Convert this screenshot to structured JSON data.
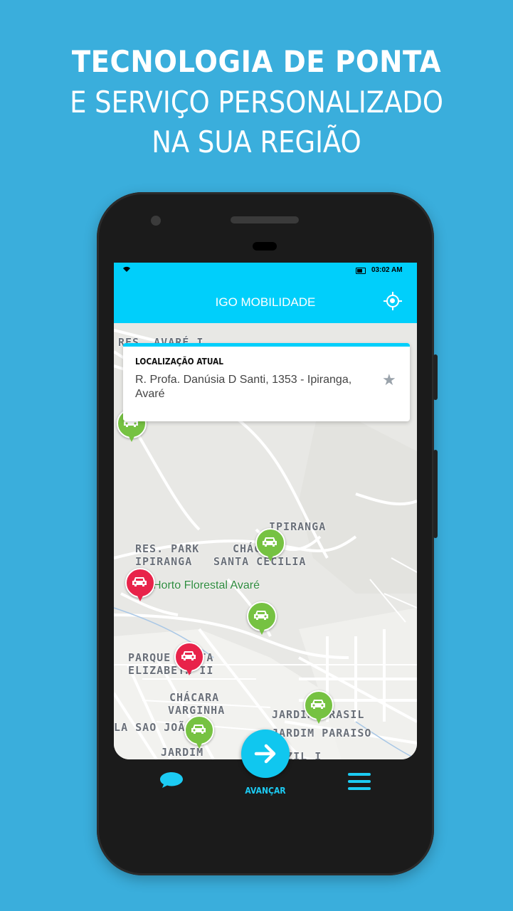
{
  "headline": {
    "line1": "TECNOLOGIA DE PONTA",
    "line2": "E SERVIÇO PERSONALIZADO",
    "line3": "NA SUA REGIÃO"
  },
  "status_bar": {
    "time": "03:02 AM"
  },
  "app_bar": {
    "title": "IGO MOBILIDADE",
    "locate_icon": "crosshair-icon"
  },
  "location_card": {
    "label": "LOCALIZAÇÃO ATUAL",
    "address": "R. Profa. Danúsia D Santi, 1353  -  Ipiranga, Avaré",
    "favorite_icon": "star-icon"
  },
  "map": {
    "labels": [
      "RES. AVARÉ I",
      "IPIRANGA",
      "RES. PARK",
      "IPIRANGA",
      "CHÁCARA",
      "SANTA CECILIA",
      "PARQUE SANTA",
      "ELIZABETH II",
      "CHÁCARA",
      "VARGINHA",
      "JARDIM BRASIL",
      "JARDIM PARAISO",
      "VILA SAO JOÃO",
      "JARDIM",
      "CRUZIL I"
    ],
    "park_label": "Horto Florestal Avaré",
    "pins": [
      {
        "color": "green"
      },
      {
        "color": "green"
      },
      {
        "color": "green"
      },
      {
        "color": "green"
      },
      {
        "color": "green"
      },
      {
        "color": "green"
      },
      {
        "color": "red"
      },
      {
        "color": "red"
      }
    ]
  },
  "bottom_nav": {
    "chat_icon": "chat-bubble-icon",
    "advance_label": "AVANÇAR",
    "advance_icon": "arrow-right-icon",
    "menu_icon": "hamburger-menu-icon"
  },
  "colors": {
    "background": "#3aaedc",
    "app_accent": "#00cffb",
    "pin_green": "#76c242",
    "pin_red": "#e8234a"
  }
}
